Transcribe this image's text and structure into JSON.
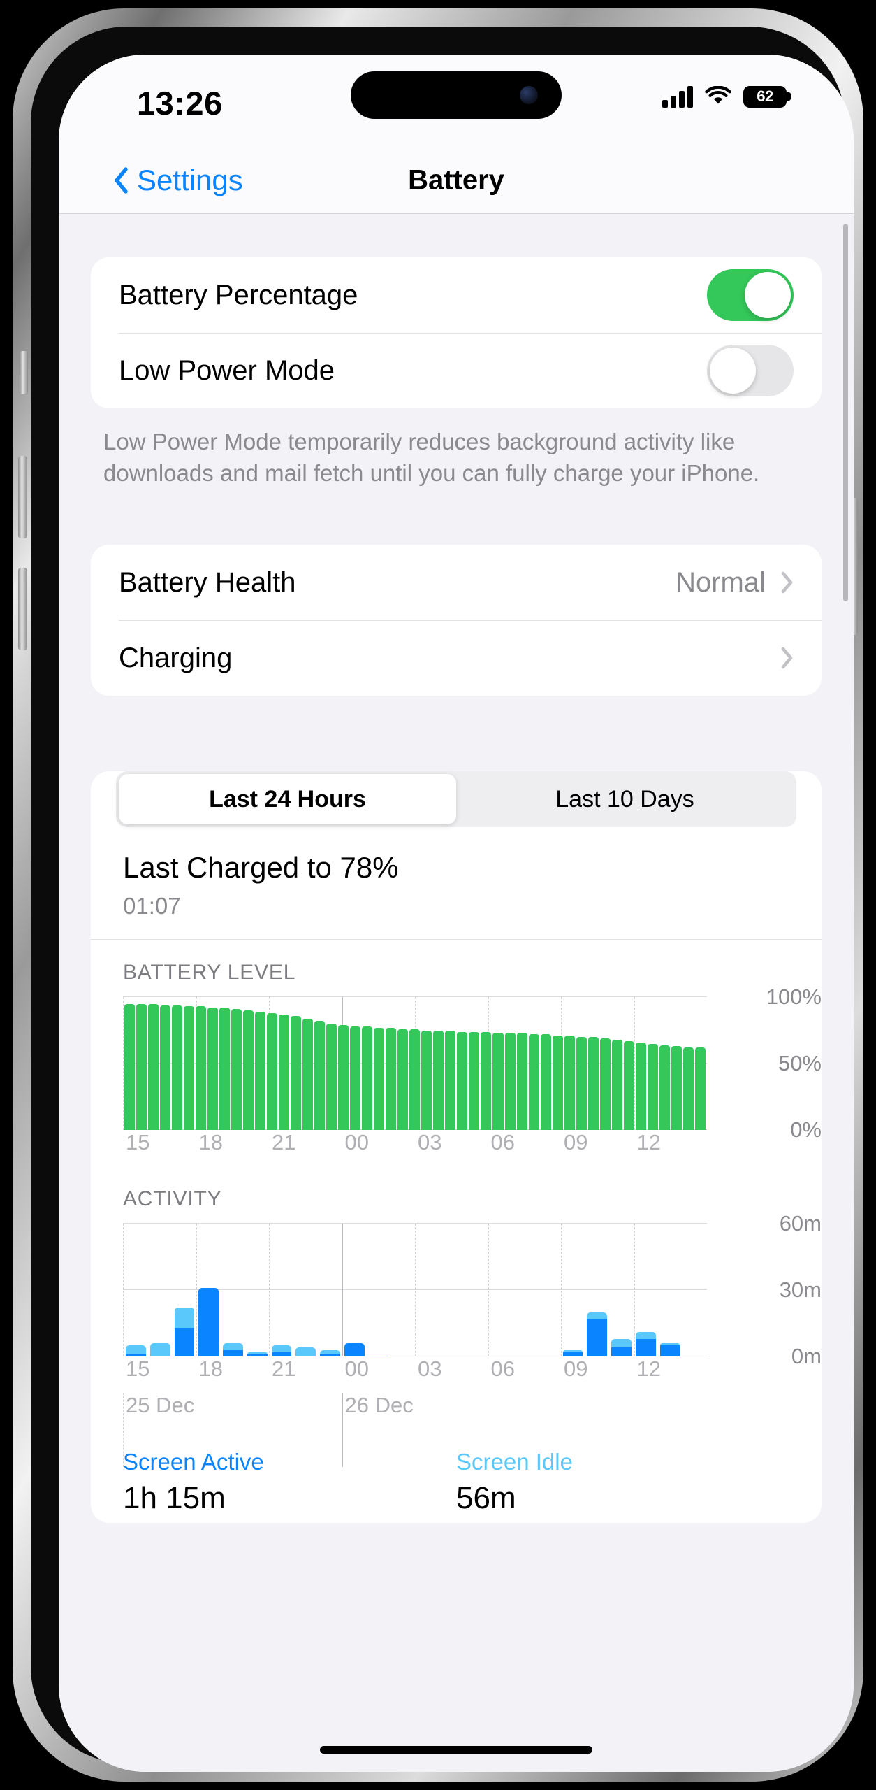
{
  "status_bar": {
    "time": "13:26",
    "battery_percent": "62",
    "signal_icon": "cellular-bars-icon",
    "wifi_icon": "wifi-icon",
    "battery_icon": "battery-icon"
  },
  "nav": {
    "back_label": "Settings",
    "back_icon": "chevron-left-icon",
    "title": "Battery"
  },
  "settings_group": {
    "rows": [
      {
        "label": "Battery Percentage",
        "control": "toggle",
        "state": "on"
      },
      {
        "label": "Low Power Mode",
        "control": "toggle",
        "state": "off"
      }
    ],
    "footnote": "Low Power Mode temporarily reduces background activity like downloads and mail fetch until you can fully charge your iPhone."
  },
  "health_group": {
    "rows": [
      {
        "label": "Battery Health",
        "value": "Normal",
        "accessory": "chevron-right-icon"
      },
      {
        "label": "Charging",
        "value": "",
        "accessory": "chevron-right-icon"
      }
    ]
  },
  "usage": {
    "segments": [
      {
        "label": "Last 24 Hours",
        "selected": true
      },
      {
        "label": "Last 10 Days",
        "selected": false
      }
    ],
    "last_charged_title": "Last Charged to 78%",
    "last_charged_time": "01:07",
    "battery_level_label": "BATTERY LEVEL",
    "activity_label": "ACTIVITY",
    "legend": [
      {
        "title": "Screen Active",
        "value": "1h 15m",
        "color": "#0a84ff"
      },
      {
        "title": "Screen Idle",
        "value": "56m",
        "color": "#5ac8fa"
      }
    ]
  },
  "colors": {
    "accent_blue": "#0a84ff",
    "light_blue": "#5ac8fa",
    "green": "#34c759",
    "bg_grouped": "#f2f2f7",
    "card": "#ffffff",
    "secondary_text": "#8a8a8e"
  },
  "chart_data": [
    {
      "type": "bar",
      "name": "battery-level",
      "title": "BATTERY LEVEL",
      "xlabel": "",
      "ylabel": "",
      "ylim": [
        0,
        100
      ],
      "yticks": [
        0,
        50,
        100
      ],
      "ytick_labels": [
        "0%",
        "50%",
        "100%"
      ],
      "grid": true,
      "xtick_labels": [
        "15",
        "18",
        "21",
        "00",
        "03",
        "06",
        "09",
        "12"
      ],
      "x": [
        "13:30",
        "14:00",
        "14:30",
        "15:00",
        "15:30",
        "16:00",
        "16:30",
        "17:00",
        "17:30",
        "18:00",
        "18:30",
        "19:00",
        "19:30",
        "20:00",
        "20:30",
        "21:00",
        "21:30",
        "22:00",
        "22:30",
        "23:00",
        "23:30",
        "00:00",
        "00:30",
        "01:00",
        "01:30",
        "02:00",
        "02:30",
        "03:00",
        "03:30",
        "04:00",
        "04:30",
        "05:00",
        "05:30",
        "06:00",
        "06:30",
        "07:00",
        "07:30",
        "08:00",
        "08:30",
        "09:00",
        "09:30",
        "10:00",
        "10:30",
        "11:00",
        "11:30",
        "12:00",
        "12:30",
        "13:00",
        "13:26"
      ],
      "values": [
        95,
        95,
        95,
        94,
        94,
        93,
        93,
        92,
        92,
        91,
        90,
        89,
        88,
        87,
        86,
        84,
        82,
        80,
        79,
        78,
        78,
        77,
        77,
        76,
        76,
        75,
        75,
        75,
        74,
        74,
        74,
        73,
        73,
        73,
        72,
        72,
        71,
        71,
        70,
        70,
        69,
        68,
        67,
        66,
        65,
        64,
        63,
        62,
        62
      ],
      "color": "#34c759"
    },
    {
      "type": "bar",
      "name": "activity",
      "title": "ACTIVITY",
      "stacked": true,
      "xlabel": "",
      "ylabel": "",
      "ylim": [
        0,
        60
      ],
      "yticks": [
        0,
        30,
        60
      ],
      "ytick_labels": [
        "0m",
        "30m",
        "60m"
      ],
      "grid": true,
      "xtick_labels": [
        "15",
        "18",
        "21",
        "00",
        "03",
        "06",
        "09",
        "12"
      ],
      "date_labels": [
        "25 Dec",
        "26 Dec"
      ],
      "x": [
        "14",
        "15",
        "16",
        "17",
        "18",
        "19",
        "20",
        "21",
        "22",
        "23",
        "00",
        "01",
        "02",
        "03",
        "04",
        "05",
        "06",
        "07",
        "08",
        "09",
        "10",
        "11",
        "12",
        "13"
      ],
      "series": [
        {
          "name": "Screen Active",
          "color": "#0a84ff",
          "values": [
            1,
            0,
            13,
            31,
            3,
            1,
            2,
            0,
            1,
            6,
            0.5,
            0,
            0,
            0,
            0,
            0,
            0,
            0,
            2,
            17,
            4,
            8,
            5,
            0
          ]
        },
        {
          "name": "Screen Idle",
          "color": "#5ac8fa",
          "values": [
            4,
            6,
            9,
            0,
            3,
            1,
            3,
            4,
            2,
            0,
            0,
            0,
            0,
            0,
            0,
            0,
            0,
            0,
            1,
            3,
            4,
            3,
            1,
            0
          ]
        }
      ]
    }
  ]
}
